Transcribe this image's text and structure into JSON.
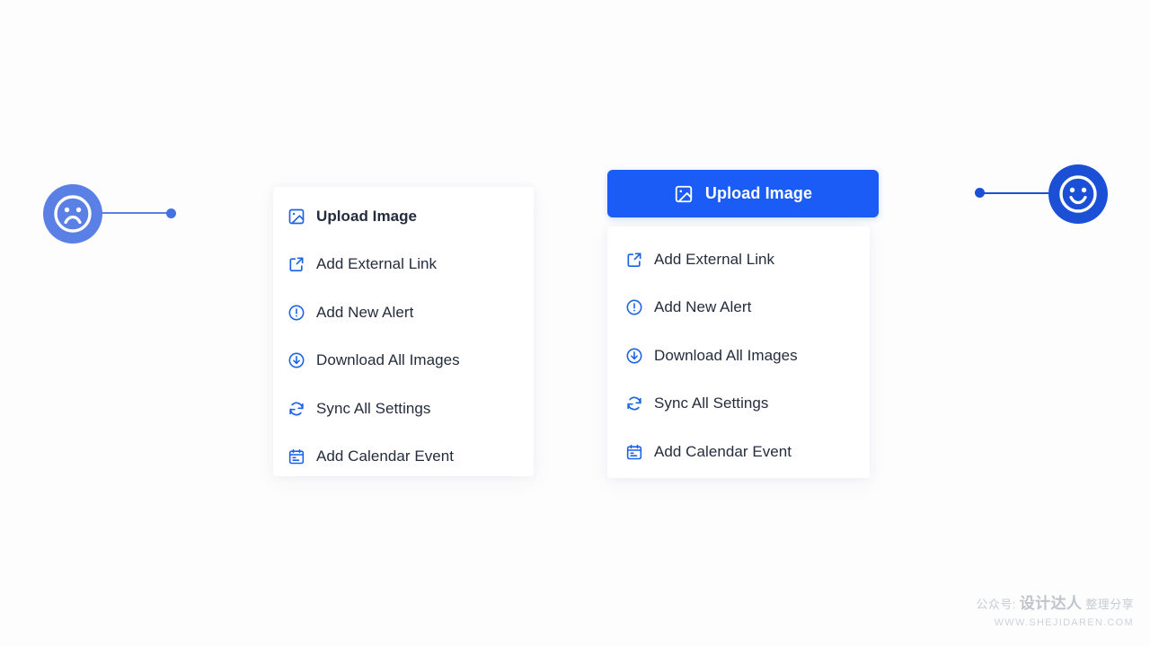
{
  "canvas": {
    "background": "#fdfdfd",
    "accent_blue": "#1a5cf5",
    "icon_blue": "#1a62e8",
    "sad_badge_color": "#5a80e6",
    "happy_badge_color": "#1a4fd6",
    "text_color": "#242c3d"
  },
  "left_example": {
    "badge": {
      "name": "sad-face",
      "icon": "frowning-face-icon"
    },
    "connector": {
      "name": "connector-line",
      "dot": "connector-dot"
    },
    "menu": {
      "items": [
        {
          "label": "Upload Image",
          "icon": "image-icon",
          "emphasis": "bold"
        },
        {
          "label": "Add External Link",
          "icon": "external-link-icon",
          "emphasis": "regular"
        },
        {
          "label": "Add New Alert",
          "icon": "alert-circle-icon",
          "emphasis": "regular"
        },
        {
          "label": "Download All Images",
          "icon": "download-icon",
          "emphasis": "regular"
        },
        {
          "label": "Sync All Settings",
          "icon": "sync-icon",
          "emphasis": "regular"
        },
        {
          "label": "Add Calendar Event",
          "icon": "calendar-icon",
          "emphasis": "regular"
        }
      ]
    }
  },
  "right_example": {
    "badge": {
      "name": "happy-face",
      "icon": "smiling-face-icon"
    },
    "connector": {
      "name": "connector-line",
      "dot": "connector-dot"
    },
    "primary_button": {
      "label": "Upload Image",
      "icon": "image-icon",
      "background": "#1a5cf5",
      "text_color": "#ffffff"
    },
    "menu": {
      "items": [
        {
          "label": "Add External Link",
          "icon": "external-link-icon",
          "emphasis": "regular"
        },
        {
          "label": "Add New Alert",
          "icon": "alert-circle-icon",
          "emphasis": "regular"
        },
        {
          "label": "Download All Images",
          "icon": "download-icon",
          "emphasis": "regular"
        },
        {
          "label": "Sync All Settings",
          "icon": "sync-icon",
          "emphasis": "regular"
        },
        {
          "label": "Add Calendar Event",
          "icon": "calendar-icon",
          "emphasis": "regular"
        }
      ]
    }
  },
  "watermark": {
    "prefix": "公众号:",
    "name": "设计达人",
    "suffix": "整理分享",
    "url": "WWW.SHEJIDAREN.COM"
  }
}
